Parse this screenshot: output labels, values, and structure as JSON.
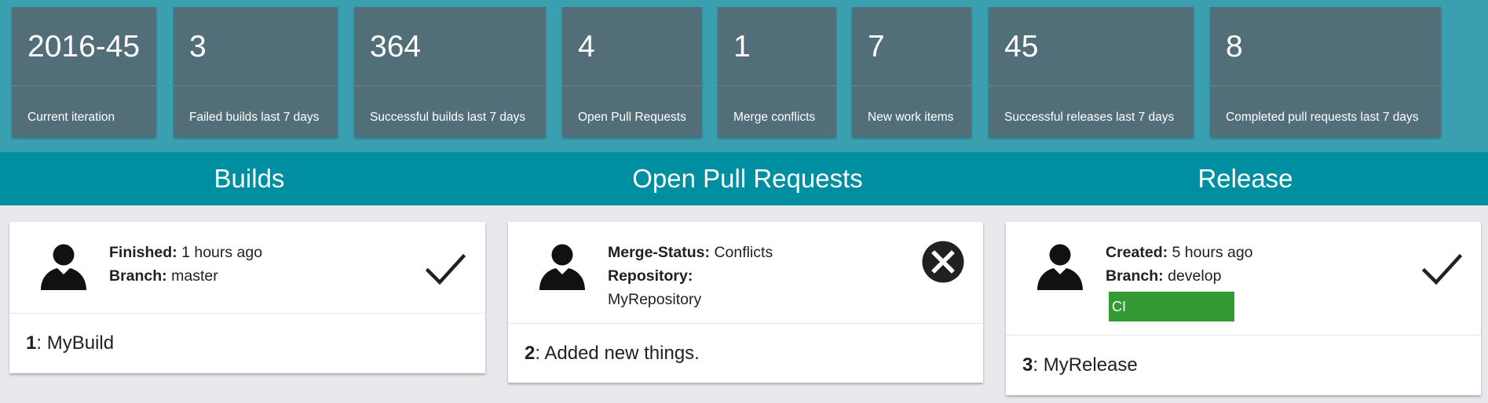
{
  "kpis": [
    {
      "value": "2016-45",
      "label": "Current iteration"
    },
    {
      "value": "3",
      "label": "Failed builds last 7 days"
    },
    {
      "value": "364",
      "label": "Successful builds last 7 days"
    },
    {
      "value": "4",
      "label": "Open Pull Requests"
    },
    {
      "value": "1",
      "label": "Merge conflicts"
    },
    {
      "value": "7",
      "label": "New work items"
    },
    {
      "value": "45",
      "label": "Successful releases last 7 days"
    },
    {
      "value": "8",
      "label": "Completed pull requests last 7 days"
    }
  ],
  "sections": {
    "builds": "Builds",
    "pull_requests": "Open Pull Requests",
    "release": "Release"
  },
  "build_card": {
    "finished_label": "Finished:",
    "finished_value": "1 hours ago",
    "branch_label": "Branch:",
    "branch_value": "master",
    "id": "1",
    "name": ": MyBuild",
    "status_icon": "checkmark-icon"
  },
  "pr_card": {
    "merge_status_label": "Merge-Status:",
    "merge_status_value": "Conflicts",
    "repository_label": "Repository:",
    "repository_value": "MyRepository",
    "id": "2",
    "name": ": Added new things.",
    "status_icon": "conflict-x-icon"
  },
  "release_card": {
    "created_label": "Created:",
    "created_value": "5 hours ago",
    "branch_label": "Branch:",
    "branch_value": "develop",
    "tag_label": "CI",
    "id": "3",
    "name": ": MyRelease",
    "status_icon": "checkmark-icon"
  },
  "colors": {
    "kpi_strip_bg": "#3aa0b0",
    "kpi_tile_bg": "#526f79",
    "section_bar_bg": "#008fa1",
    "page_bg": "#e8e9ec",
    "tag_green": "#339933"
  }
}
